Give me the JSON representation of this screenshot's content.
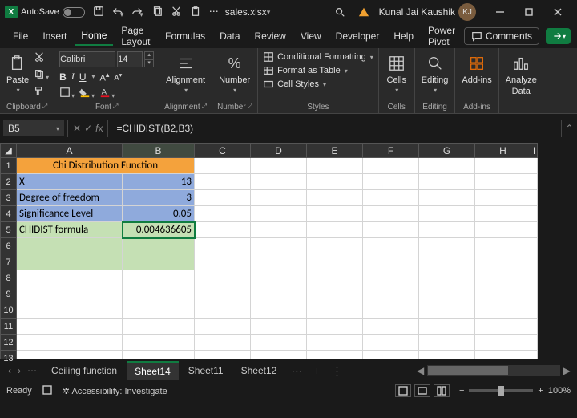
{
  "titlebar": {
    "autosave": "AutoSave",
    "filename": "sales.xlsx",
    "user": "Kunal Jai Kaushik",
    "user_initials": "KJ"
  },
  "tabs": [
    "File",
    "Insert",
    "Home",
    "Page Layout",
    "Formulas",
    "Data",
    "Review",
    "View",
    "Developer",
    "Help",
    "Power Pivot"
  ],
  "active_tab": "Home",
  "comments_label": "Comments",
  "ribbon": {
    "clipboard": {
      "label": "Clipboard",
      "paste": "Paste"
    },
    "font": {
      "label": "Font",
      "name": "Calibri",
      "size": "14",
      "bold": "B",
      "italic": "I",
      "underline": "U"
    },
    "alignment": {
      "label": "Alignment",
      "btn": "Alignment"
    },
    "number": {
      "label": "Number",
      "btn": "Number"
    },
    "styles": {
      "label": "Styles",
      "cond": "Conditional Formatting",
      "table": "Format as Table",
      "cell": "Cell Styles"
    },
    "cells": {
      "label": "Cells",
      "btn": "Cells"
    },
    "editing": {
      "label": "Editing",
      "btn": "Editing"
    },
    "addins": {
      "label": "Add-ins",
      "btn": "Add-ins"
    },
    "analyze": {
      "btn": "Analyze",
      "btn2": "Data"
    }
  },
  "formula_bar": {
    "name_box": "B5",
    "formula": "=CHIDIST(B2,B3)"
  },
  "columns": [
    "A",
    "B",
    "C",
    "D",
    "E",
    "F",
    "G",
    "H",
    "I"
  ],
  "rows": [
    "1",
    "2",
    "3",
    "4",
    "5",
    "6",
    "7",
    "8",
    "9",
    "10",
    "11",
    "12",
    "13"
  ],
  "cells": {
    "A1": "Chi Distribution Function",
    "A2": "X",
    "B2": "13",
    "A3": "Degree of freedom",
    "B3": "3",
    "A4": "Significance Level",
    "B4": "0.05",
    "A5": "CHIDIST formula",
    "B5": "0.004636605"
  },
  "sheets": [
    "Ceiling function",
    "Sheet14",
    "Sheet11",
    "Sheet12"
  ],
  "active_sheet": "Sheet14",
  "status": {
    "ready": "Ready",
    "access": "Accessibility: Investigate",
    "zoom": "100%"
  }
}
